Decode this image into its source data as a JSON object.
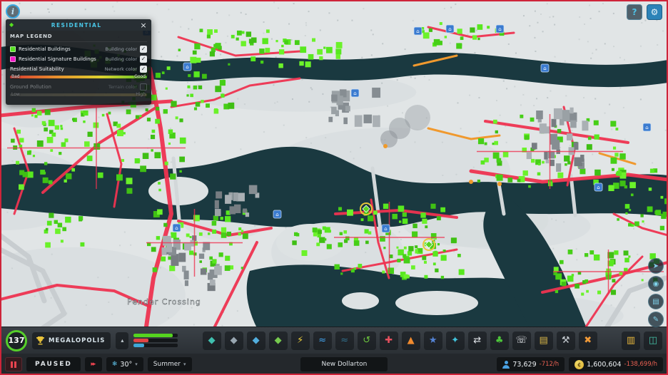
{
  "icons": {
    "info": "i",
    "help": "?",
    "gear": "⚙",
    "close": "×",
    "check": "✓",
    "snowflake": "❄",
    "caret_down": "▾",
    "speed": "▸▸",
    "money": "¢",
    "expand": "▴"
  },
  "legend_panel": {
    "title": "RESIDENTIAL",
    "section_title": "MAP LEGEND",
    "rows": [
      {
        "label": "Residential Buildings",
        "type_label": "Building color",
        "swatch": "#55e020",
        "checked": true,
        "dimmed": false
      },
      {
        "label": "Residential Signature Buildings",
        "type_label": "Building color",
        "swatch": "#f318c8",
        "checked": true,
        "dimmed": false
      },
      {
        "label": "Residential Suitability",
        "type_label": "Network color",
        "checked": true,
        "dimmed": false,
        "gradient": {
          "start_label": "Bad",
          "end_label": "Good",
          "colors": [
            "#d93a30",
            "#e88f2e",
            "#ddd32f",
            "#56c226"
          ]
        }
      },
      {
        "label": "Ground Pollution",
        "type_label": "Terrain color",
        "checked": false,
        "dimmed": true,
        "gradient": {
          "start_label": "Low",
          "end_label": "High",
          "colors": [
            "#63655f",
            "#7a7150",
            "#8b7a45"
          ]
        }
      }
    ]
  },
  "map": {
    "district_label": "Pender Crossing"
  },
  "floating_buttons": [
    {
      "name": "chirper-button",
      "glyph": "➤"
    },
    {
      "name": "photo-mode-button",
      "glyph": "◉"
    },
    {
      "name": "statistics-button",
      "glyph": "▤"
    },
    {
      "name": "notes-button",
      "glyph": "✎"
    }
  ],
  "toolbar": {
    "milestone_level": "137",
    "milestone_name": "MEGALOPOLIS",
    "tools": [
      {
        "name": "zones-tool",
        "glyph": "◆",
        "color": "#3fbfae"
      },
      {
        "name": "roads-tool",
        "glyph": "◆",
        "color": "#98a6b0"
      },
      {
        "name": "landscaping-tool",
        "glyph": "◆",
        "color": "#52aede"
      },
      {
        "name": "signature-tool",
        "glyph": "◆",
        "color": "#76c94e"
      },
      {
        "name": "electricity-tool",
        "glyph": "⚡",
        "color": "#f0d23c"
      },
      {
        "name": "water-tool",
        "glyph": "≈",
        "color": "#42a4ee"
      },
      {
        "name": "sewage-tool",
        "glyph": "≈",
        "color": "#31708c"
      },
      {
        "name": "garbage-tool",
        "glyph": "↺",
        "color": "#6cc43e"
      },
      {
        "name": "healthcare-tool",
        "glyph": "✚",
        "color": "#e8505e"
      },
      {
        "name": "fire-rescue-tool",
        "glyph": "▲",
        "color": "#f08a2e"
      },
      {
        "name": "police-tool",
        "glyph": "★",
        "color": "#5484d6"
      },
      {
        "name": "education-tool",
        "glyph": "✦",
        "color": "#41c2da"
      },
      {
        "name": "transportation-tool",
        "glyph": "⇄",
        "color": "#dfe4e8"
      },
      {
        "name": "parks-tool",
        "glyph": "♣",
        "color": "#4cc43a"
      },
      {
        "name": "communications-tool",
        "glyph": "☏",
        "color": "#e6eaed"
      },
      {
        "name": "economy-tool",
        "glyph": "▤",
        "color": "#d8b648"
      },
      {
        "name": "maintenance-tool",
        "glyph": "⚒",
        "color": "#c6ccd1"
      },
      {
        "name": "bulldoze-tool",
        "glyph": "✖",
        "color": "#f09a38"
      }
    ],
    "right_tools": [
      {
        "name": "city-statistics-tool",
        "glyph": "▥",
        "color": "#e8b83c"
      },
      {
        "name": "infoviews-tool",
        "glyph": "◫",
        "color": "#45c0a6"
      }
    ]
  },
  "status_bar": {
    "paused_label": "PAUSED",
    "temperature": "30°",
    "season": "Summer",
    "city_name": "New Dollarton",
    "population": "73,629",
    "population_rate": "-712/h",
    "money": "1,600,604",
    "money_rate": "-138,699/h"
  }
}
